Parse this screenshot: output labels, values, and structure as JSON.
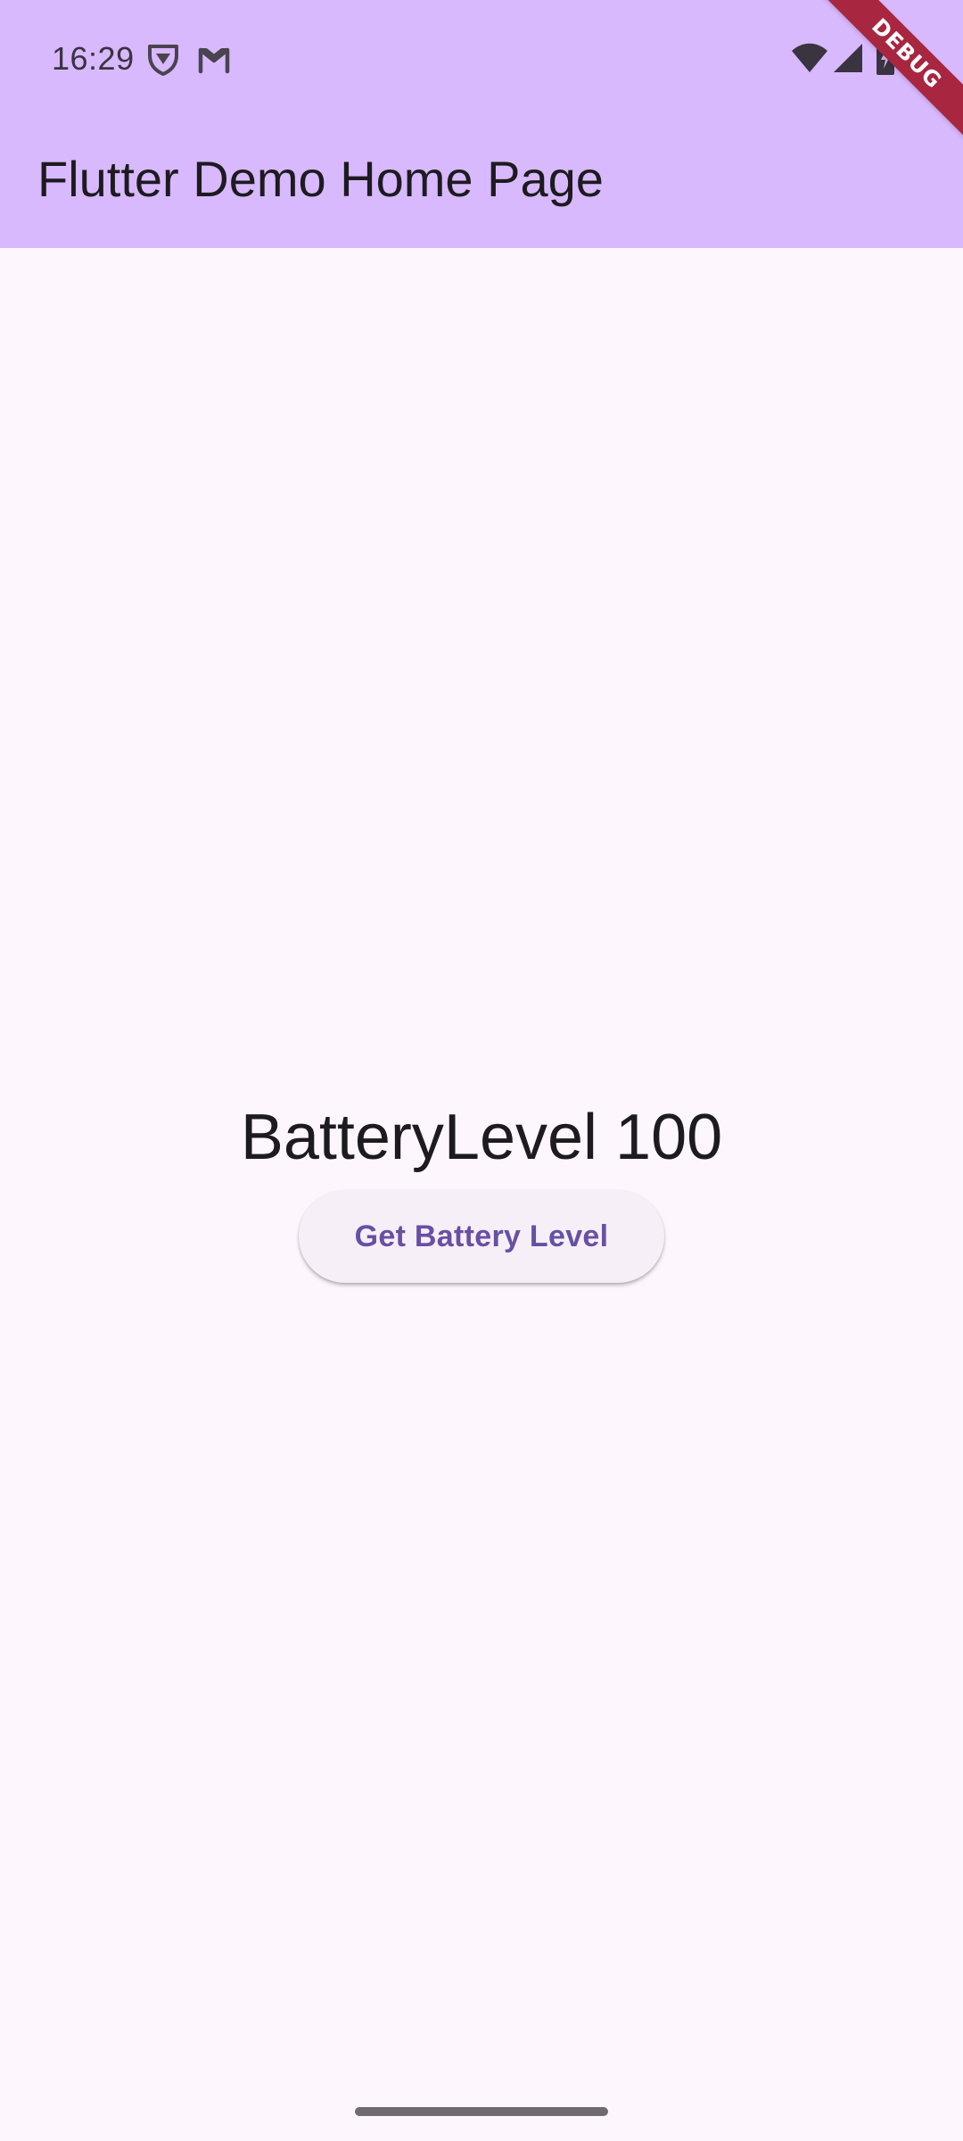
{
  "status_bar": {
    "time": "16:29",
    "icons": [
      "shield-notification-icon",
      "gmail-icon",
      "wifi-icon",
      "cellular-signal-icon",
      "battery-charging-icon"
    ]
  },
  "app_bar": {
    "title": "Flutter Demo Home Page",
    "background_color": "#d8b9fe"
  },
  "debug_banner": {
    "label": "DEBUG",
    "color": "#a8263f"
  },
  "main": {
    "battery_text": "BatteryLevel 100",
    "button_label": "Get Battery Level",
    "button_text_color": "#6750a4",
    "background_color": "#fdf7fd"
  }
}
